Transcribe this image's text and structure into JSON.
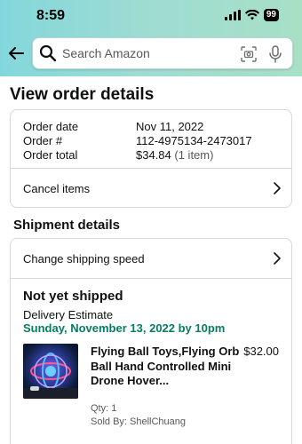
{
  "status_bar": {
    "time": "8:59",
    "battery": "99"
  },
  "search": {
    "placeholder": "Search Amazon"
  },
  "page": {
    "title": "View order details"
  },
  "order": {
    "rows": [
      {
        "label": "Order date",
        "value": "Nov 11, 2022"
      },
      {
        "label": "Order #",
        "value": "112-4975134-2473017"
      },
      {
        "label": "Order total",
        "value": "$34.84",
        "value_suffix": "(1 item)"
      }
    ],
    "cancel_label": "Cancel items"
  },
  "shipment": {
    "section_title": "Shipment details",
    "change_speed_label": "Change shipping speed",
    "status": "Not yet shipped",
    "delivery_label": "Delivery Estimate",
    "delivery_date": "Sunday, November 13, 2022 by 10pm",
    "item": {
      "title": "Flying Ball Toys,Flying Orb Ball Hand Controlled Mini Drone Hover...",
      "price": "$32.00",
      "qty": "Qty: 1",
      "sold_by": "Sold By: ShellChuang"
    }
  },
  "colors": {
    "accent_green": "#067d62",
    "header_start": "#83d7dc",
    "header_end": "#a8e0c6"
  },
  "icons": [
    "back-arrow-icon",
    "search-icon",
    "camera-icon",
    "mic-icon",
    "chevron-right-icon",
    "signal-icon",
    "wifi-icon"
  ]
}
